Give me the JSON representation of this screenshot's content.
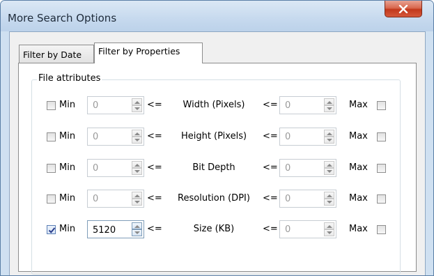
{
  "window": {
    "title": "More Search Options",
    "close_icon": "close-icon"
  },
  "tabs": [
    {
      "label": "Filter by Date",
      "active": false
    },
    {
      "label": "Filter by Properties",
      "active": true
    }
  ],
  "group": {
    "legend": "File attributes",
    "min_label": "Min",
    "max_label": "Max",
    "le_label": "<=",
    "rows": [
      {
        "property": "Width (Pixels)",
        "min_checked": false,
        "min_value": "0",
        "max_value": "0",
        "max_checked": false
      },
      {
        "property": "Height (Pixels)",
        "min_checked": false,
        "min_value": "0",
        "max_value": "0",
        "max_checked": false
      },
      {
        "property": "Bit Depth",
        "min_checked": false,
        "min_value": "0",
        "max_value": "0",
        "max_checked": false
      },
      {
        "property": "Resolution (DPI)",
        "min_checked": false,
        "min_value": "0",
        "max_value": "0",
        "max_checked": false
      },
      {
        "property": "Size (KB)",
        "min_checked": true,
        "min_value": "5120",
        "max_value": "0",
        "max_checked": false
      }
    ]
  }
}
